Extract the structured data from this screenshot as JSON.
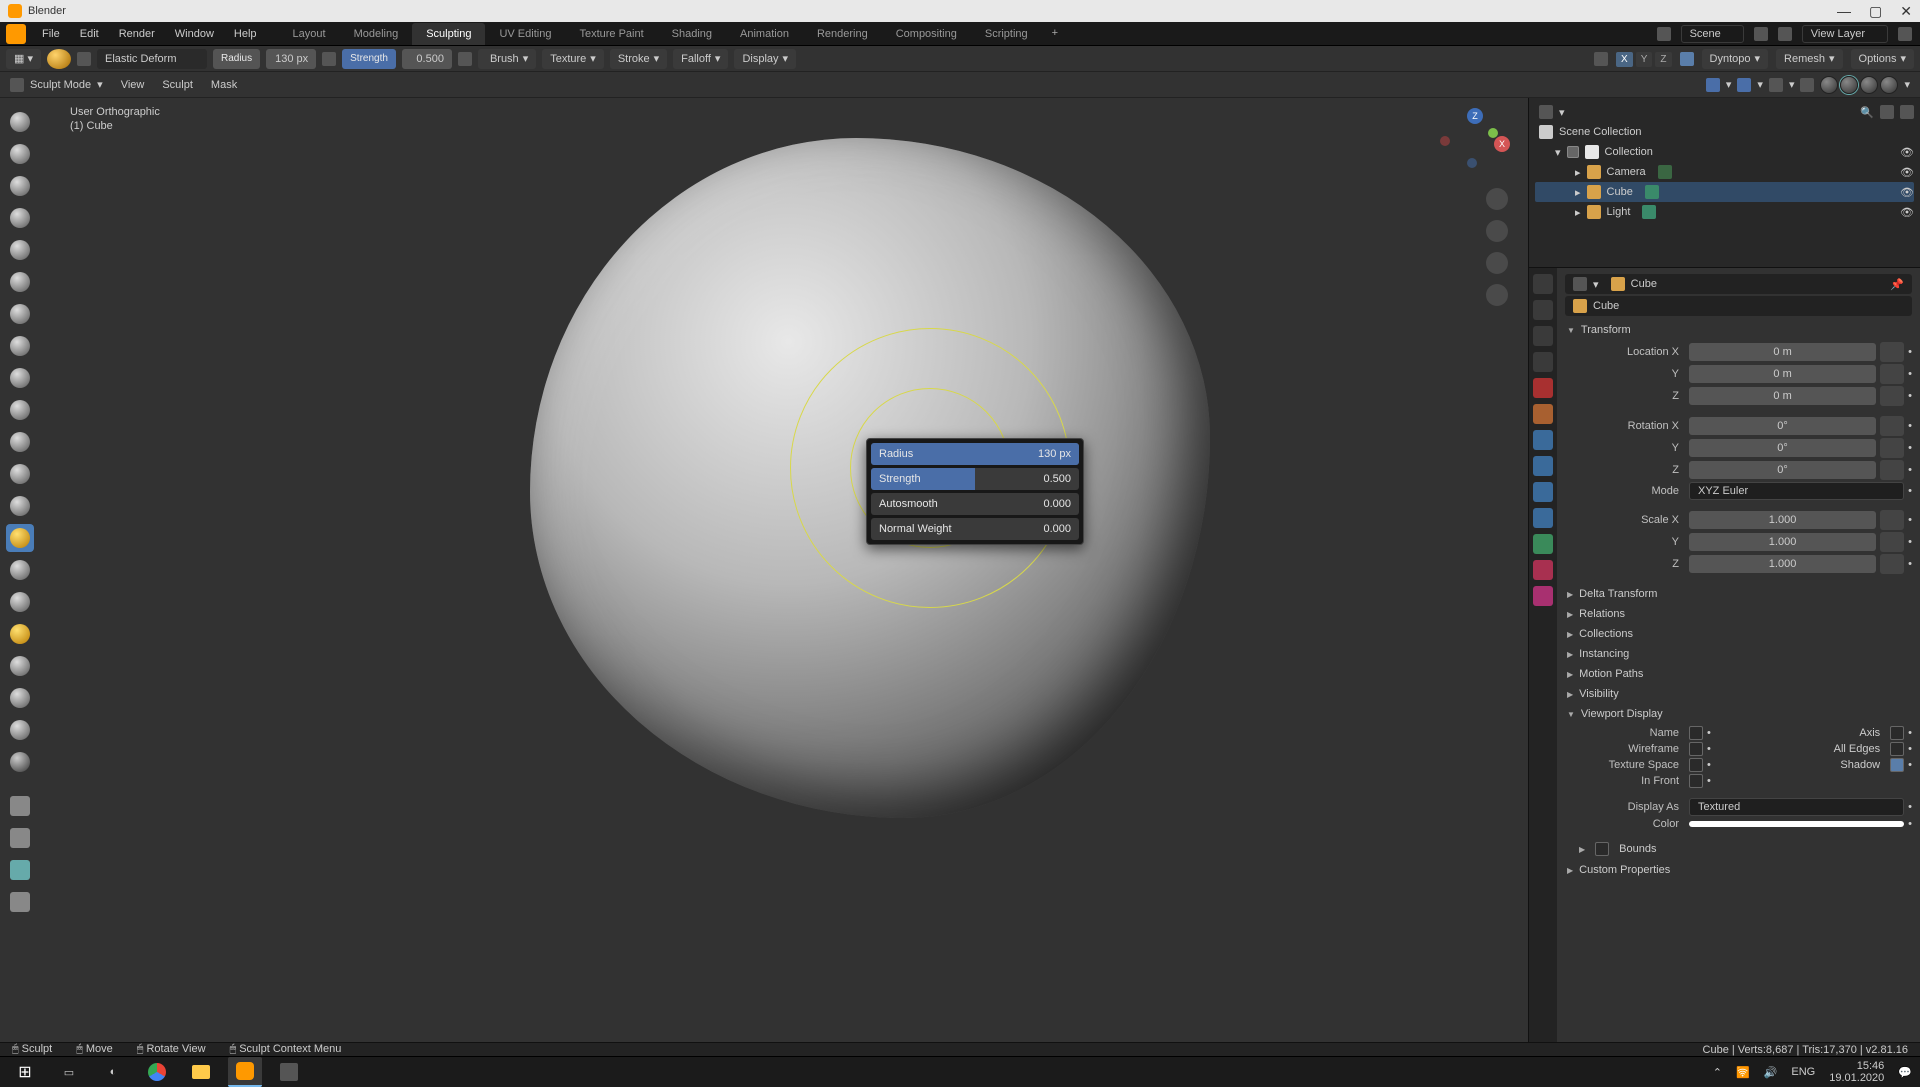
{
  "window": {
    "title": "Blender"
  },
  "top_menu": [
    "File",
    "Edit",
    "Render",
    "Window",
    "Help"
  ],
  "workspaces": [
    "Layout",
    "Modeling",
    "Sculpting",
    "UV Editing",
    "Texture Paint",
    "Shading",
    "Animation",
    "Rendering",
    "Compositing",
    "Scripting"
  ],
  "workspace_active": "Sculpting",
  "scene": {
    "label": "Scene",
    "view_layer": "View Layer"
  },
  "header2": {
    "brush_name": "Elastic Deform",
    "radius_label": "Radius",
    "radius_value": "130 px",
    "strength_label": "Strength",
    "strength_value": "0.500",
    "dropdowns": [
      "Brush",
      "Texture",
      "Stroke",
      "Falloff",
      "Display"
    ],
    "xyz": [
      "X",
      "Y",
      "Z"
    ],
    "right_dd": [
      "Dyntopo",
      "Remesh",
      "Options"
    ]
  },
  "header3": {
    "mode": "Sculpt Mode",
    "menus": [
      "View",
      "Sculpt",
      "Mask"
    ]
  },
  "overlay": {
    "line1": "User Orthographic",
    "line2": "(1) Cube"
  },
  "popup": {
    "rows": [
      {
        "label": "Radius",
        "value": "130 px",
        "fill": 100
      },
      {
        "label": "Strength",
        "value": "0.500",
        "fill": 50
      },
      {
        "label": "Autosmooth",
        "value": "0.000",
        "fill": 0
      },
      {
        "label": "Normal Weight",
        "value": "0.000",
        "fill": 0
      }
    ]
  },
  "outliner": {
    "header": "Scene Collection",
    "collection": "Collection",
    "items": [
      {
        "name": "Camera"
      },
      {
        "name": "Cube"
      },
      {
        "name": "Light"
      }
    ]
  },
  "properties": {
    "obj_icon_label": "Cube",
    "obj_name": "Cube",
    "sections": {
      "transform": {
        "title": "Transform",
        "loc": {
          "label": "Location X",
          "x": "0 m",
          "y_label": "Y",
          "y": "0 m",
          "z_label": "Z",
          "z": "0 m"
        },
        "rot": {
          "label": "Rotation X",
          "x": "0°",
          "y_label": "Y",
          "y": "0°",
          "z_label": "Z",
          "z": "0°"
        },
        "mode_label": "Mode",
        "mode": "XYZ Euler",
        "scale": {
          "label": "Scale X",
          "x": "1.000",
          "y_label": "Y",
          "y": "1.000",
          "z_label": "Z",
          "z": "1.000"
        }
      },
      "collapsed": [
        "Delta Transform",
        "Relations",
        "Collections",
        "Instancing",
        "Motion Paths",
        "Visibility"
      ],
      "viewport": {
        "title": "Viewport Display",
        "rows": [
          {
            "l": "Name",
            "r": "Axis"
          },
          {
            "l": "Wireframe",
            "r": "All Edges"
          },
          {
            "l": "Texture Space",
            "r": "Shadow"
          },
          {
            "l": "In Front",
            "r": ""
          }
        ],
        "display_as_label": "Display As",
        "display_as": "Textured",
        "color_label": "Color",
        "bounds": "Bounds"
      },
      "custom": "Custom Properties"
    }
  },
  "status": {
    "items": [
      "Sculpt",
      "Move",
      "Rotate View",
      "Sculpt Context Menu"
    ],
    "right": "Cube | Verts:8,687 | Tris:17,370 | v2.81.16"
  },
  "taskbar": {
    "lang": "ENG",
    "time": "15:46",
    "date": "19.01.2020"
  }
}
